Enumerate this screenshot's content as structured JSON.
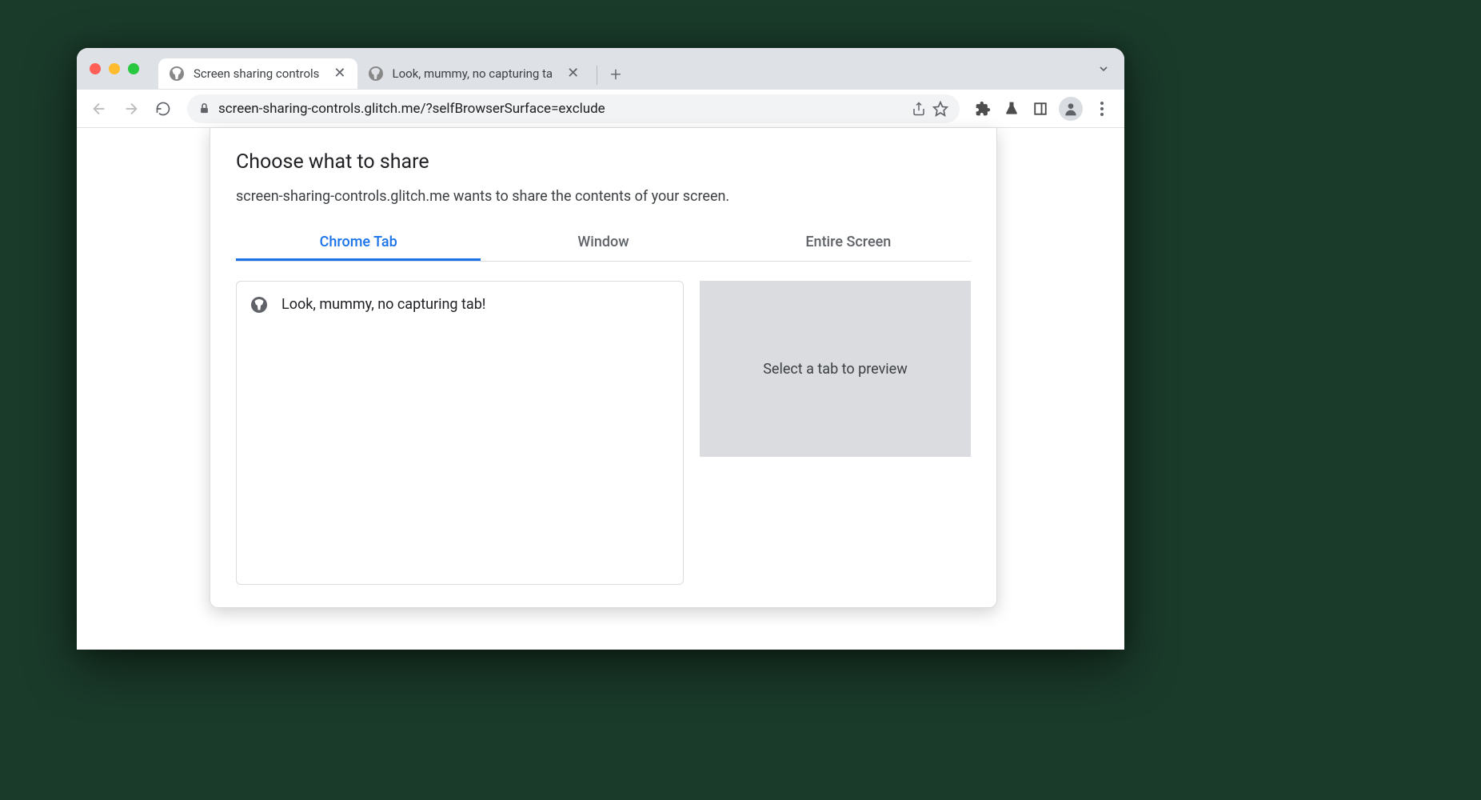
{
  "browser": {
    "tabs": [
      {
        "title": "Screen sharing controls",
        "active": true
      },
      {
        "title": "Look, mummy, no capturing ta",
        "active": false
      }
    ],
    "url": "screen-sharing-controls.glitch.me/?selfBrowserSurface=exclude"
  },
  "dialog": {
    "title": "Choose what to share",
    "description": "screen-sharing-controls.glitch.me wants to share the contents of your screen.",
    "tabs": [
      {
        "label": "Chrome Tab",
        "active": true
      },
      {
        "label": "Window",
        "active": false
      },
      {
        "label": "Entire Screen",
        "active": false
      }
    ],
    "list_items": [
      {
        "title": "Look, mummy, no capturing tab!"
      }
    ],
    "preview_placeholder": "Select a tab to preview"
  }
}
